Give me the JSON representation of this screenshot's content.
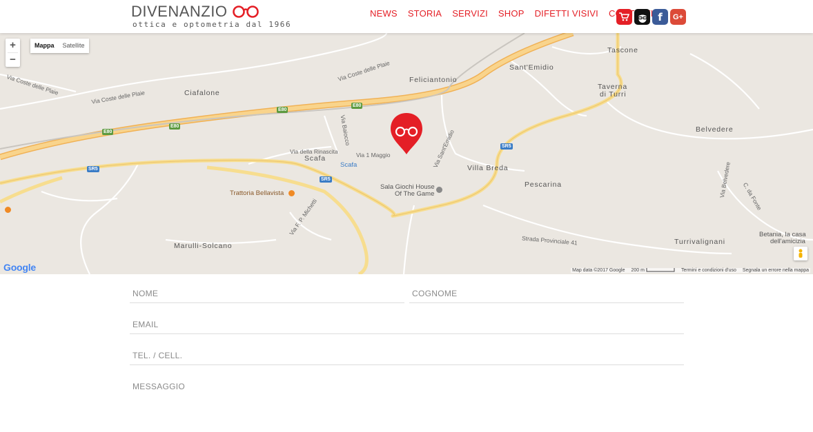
{
  "header": {
    "logo_name": "DIVENANZIO",
    "logo_tagline": "ottica e optometria dal 1966",
    "nav": [
      "NEWS",
      "STORIA",
      "SERVIZI",
      "SHOP",
      "DIFETTI VISIVI",
      "CONTATTI"
    ],
    "social_icons": [
      "cart-icon",
      "face-glasses-icon",
      "facebook-icon",
      "google-plus-icon"
    ],
    "facebook_glyph": "f",
    "google_plus_glyph": "G+"
  },
  "colors": {
    "brand_red": "#e41f26",
    "facebook": "#3b5b98",
    "google_plus": "#dc4a38",
    "map_bg": "#ebe7e1",
    "highway": "#f5c66a"
  },
  "map": {
    "zoom_in": "+",
    "zoom_out": "−",
    "map_type_selected": "Mappa",
    "map_type_other": "Satellite",
    "places": {
      "tascone": "Tascone",
      "santemidio": "Sant'Emidio",
      "feliciantonio": "Feliciantonio",
      "ciafalone": "Ciafalone",
      "taverna": "Taverna",
      "di_turri": "di Turri",
      "belvedere": "Belvedere",
      "scafa": "Scafa",
      "villa_breda": "Villa Breda",
      "pescarina": "Pescarina",
      "marulli": "Marulli-Solcano",
      "turrivalignani": "Turrivalignani"
    },
    "streets": {
      "coste_plaie_1": "Via Coste delle Plaie",
      "coste_plaie_2": "Via Coste delle Plaie",
      "coste_plaie_3": "Via Coste delle Plaie",
      "baiocco": "Via Baiocco",
      "rinascita": "Via della Rinascita",
      "maggio": "Via 1 Maggio",
      "santemidio": "Via Sant'Emidio",
      "michetti": "Via F. P. Michetti",
      "via_belvedere": "Via Belvedere",
      "c_da_fonte": "C. da Fonte",
      "provinciale": "Strada Provinciale 41"
    },
    "shields": {
      "e80_a": "E80",
      "e80_b": "E80",
      "e80_c": "E80",
      "e80_d": "E80",
      "sr5_a": "SR5",
      "sr5_b": "SR5",
      "sr5_c": "SR5"
    },
    "pois": {
      "scafa_station": "Scafa",
      "trattoria": "Trattoria Bellavista",
      "sala_giochi_1": "Sala Giochi House",
      "sala_giochi_2": "Of The Game",
      "betania_1": "Betania, la casa",
      "betania_2": "dell'amicizia"
    },
    "google_logo": "Google",
    "attribution": {
      "map_data": "Map data ©2017 Google",
      "scale": "200 m",
      "terms": "Termini e condizioni d'uso",
      "report": "Segnala un errore nella mappa"
    }
  },
  "form": {
    "nome_placeholder": "NOME",
    "cognome_placeholder": "COGNOME",
    "email_placeholder": "EMAIL",
    "tel_placeholder": "TEL. / CELL.",
    "messaggio_placeholder": "MESSAGGIO"
  }
}
